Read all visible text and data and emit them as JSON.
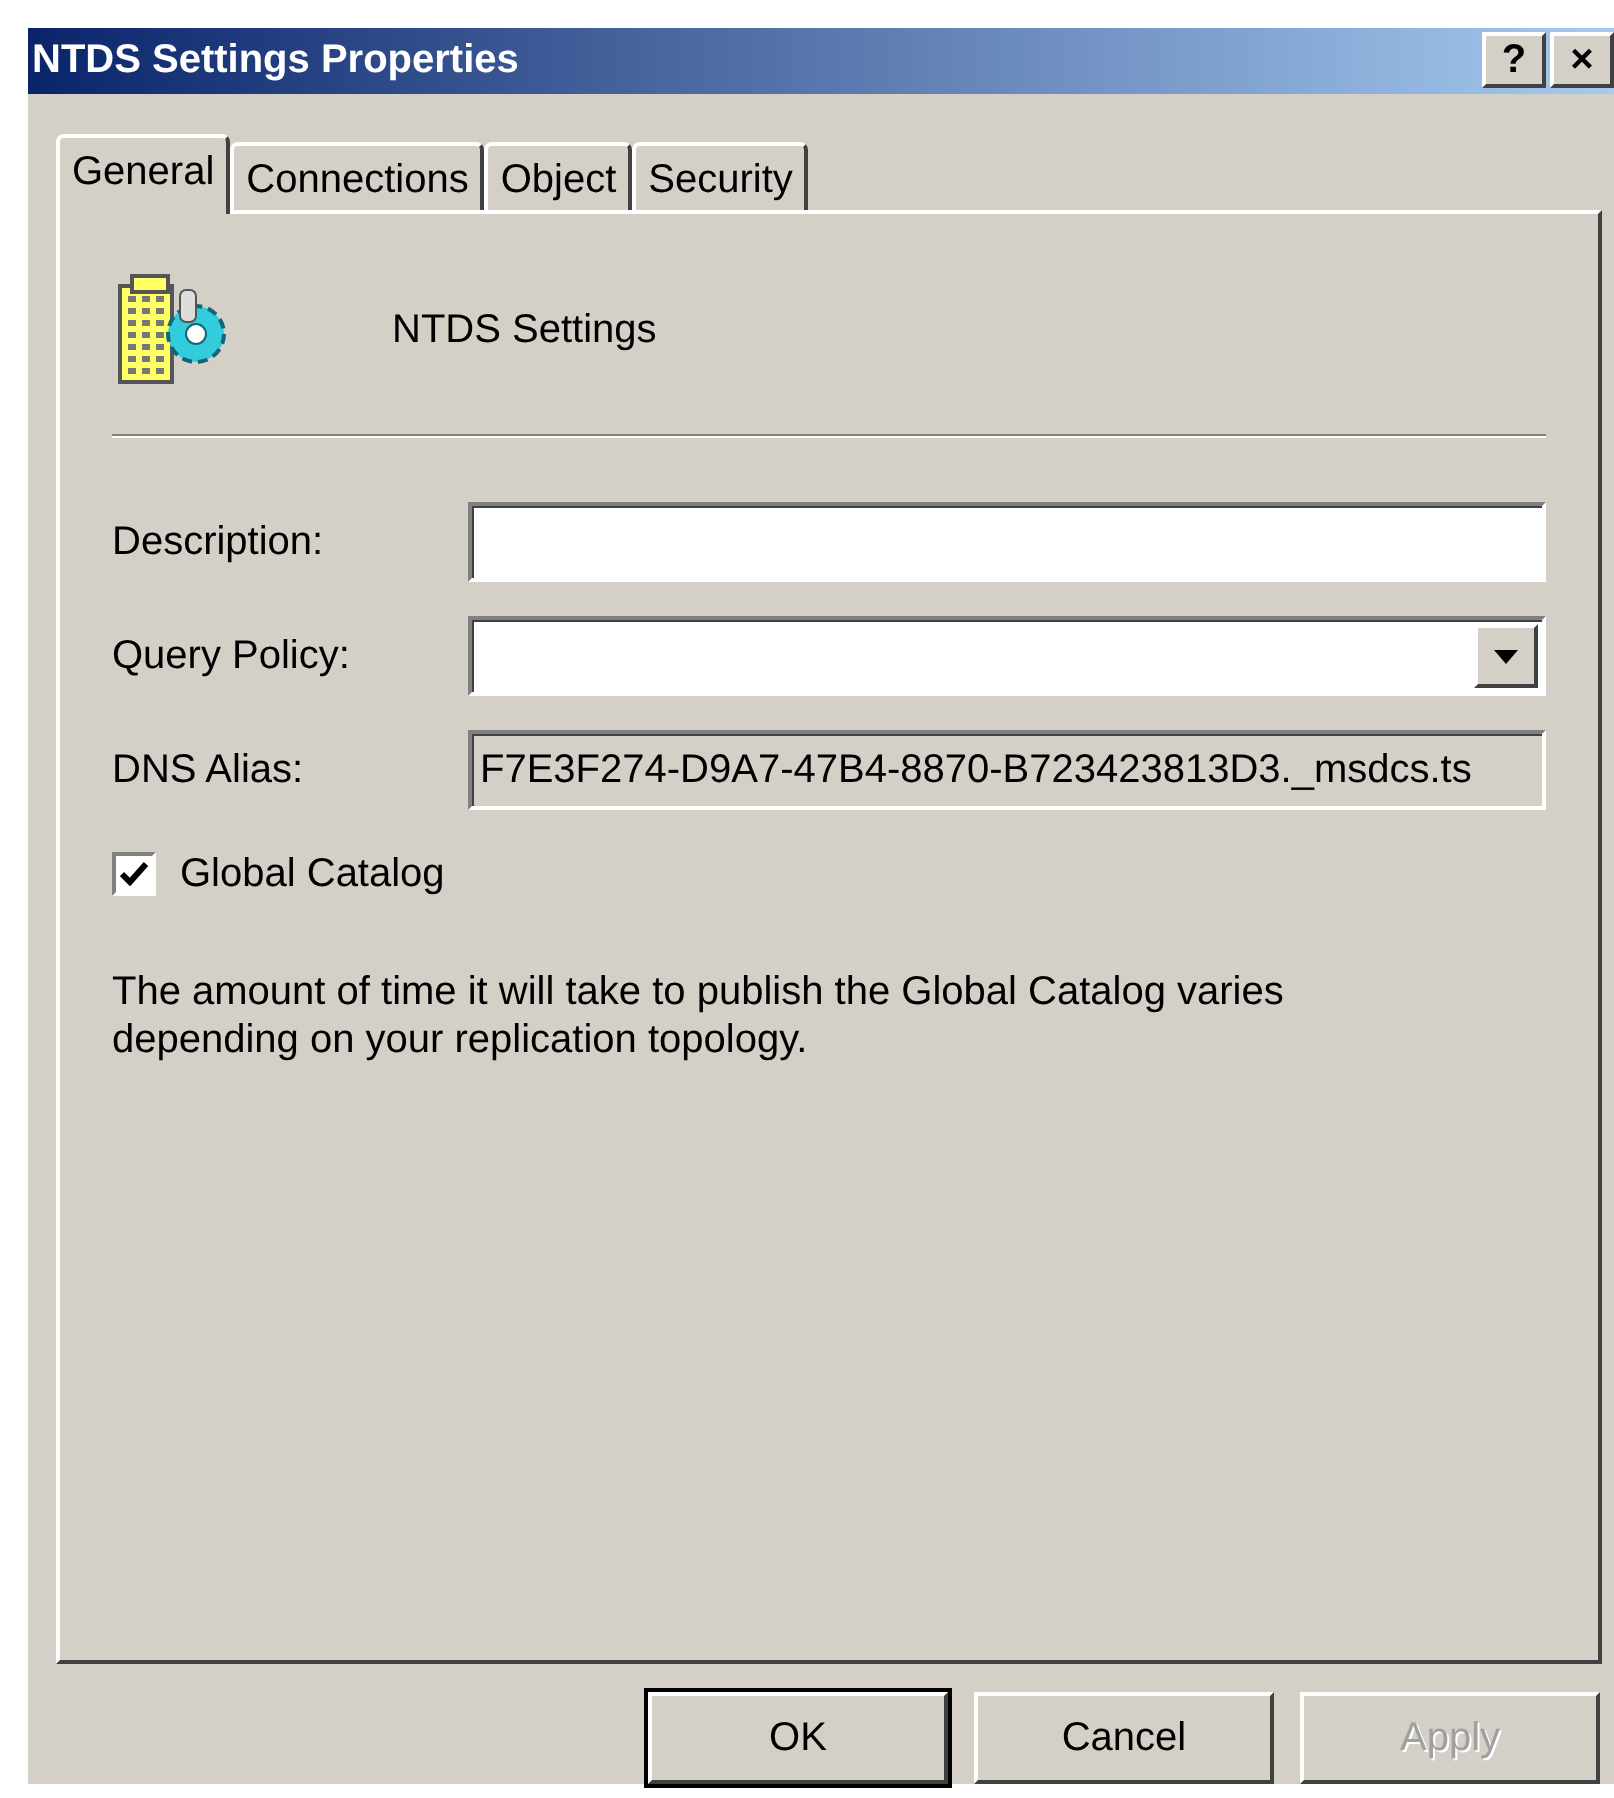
{
  "window": {
    "title": "NTDS Settings Properties",
    "title_buttons": [
      "?",
      "×"
    ]
  },
  "tabs": [
    {
      "label": "General",
      "selected": true
    },
    {
      "label": "Connections",
      "selected": false
    },
    {
      "label": "Object",
      "selected": false
    },
    {
      "label": "Security",
      "selected": false
    }
  ],
  "object_name": "NTDS Settings",
  "fields": [
    {
      "kind": "text",
      "label": "Description:",
      "disabled": false
    },
    {
      "kind": "dropdown",
      "label": "Query Policy:",
      "disabled": false
    },
    {
      "kind": "text",
      "label": "DNS Alias:",
      "value": "F7E3F274-D9A7-47B4-8870-B723423813D3._msdcs.ts",
      "disabled": true
    }
  ],
  "global_catalog": {
    "label": "Global Catalog",
    "checked": true
  },
  "note": "The amount of time it will take to publish the Global Catalog varies depending on your replication topology.",
  "buttons": [
    {
      "label": "OK",
      "default": true,
      "disabled": false
    },
    {
      "label": "Cancel",
      "default": false,
      "disabled": false
    },
    {
      "label": "Apply",
      "default": false,
      "disabled": true
    }
  ]
}
